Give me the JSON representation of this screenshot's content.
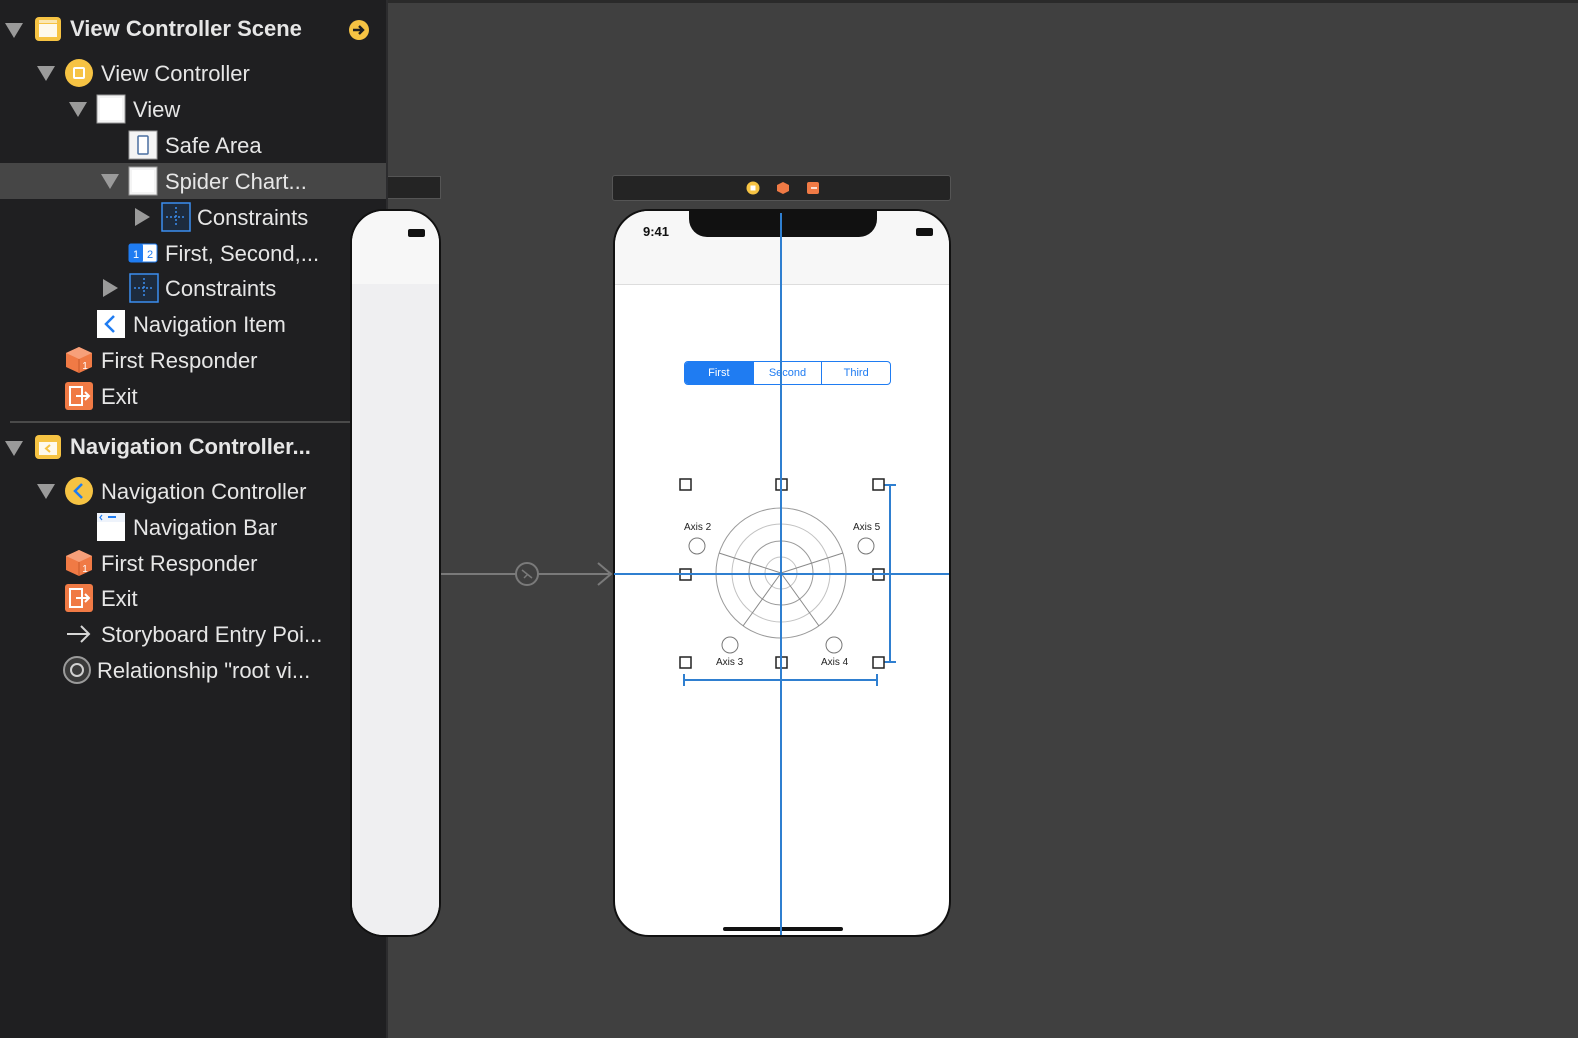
{
  "outline": {
    "scene1_title": "View Controller Scene",
    "view_controller": "View Controller",
    "view": "View",
    "safe_area": "Safe Area",
    "spider_chart": "Spider Chart...",
    "constraints_inner": "Constraints",
    "first_second": "First, Second,...",
    "constraints_outer": "Constraints",
    "navigation_item": "Navigation Item",
    "first_responder_1": "First Responder",
    "exit_1": "Exit",
    "scene2_title": "Navigation Controller...",
    "navigation_controller": "Navigation Controller",
    "navigation_bar": "Navigation Bar",
    "first_responder_2": "First Responder",
    "exit_2": "Exit",
    "storyboard_entry": "Storyboard Entry Poi...",
    "relationship": "Relationship \"root vi..."
  },
  "phone": {
    "time": "9:41",
    "segments": [
      "First",
      "Second",
      "Third"
    ],
    "axis_labels": {
      "axis2": "Axis 2",
      "axis5": "Axis 5",
      "axis3": "Axis 3",
      "axis4": "Axis 4"
    }
  },
  "colors": {
    "accent": "#1f7cf2",
    "guide": "#2f7fd0",
    "sidebar_bg": "#1f1f21",
    "canvas_bg": "#404040",
    "scene_icon": "#f6c343",
    "exit_icon": "#f07a45"
  }
}
